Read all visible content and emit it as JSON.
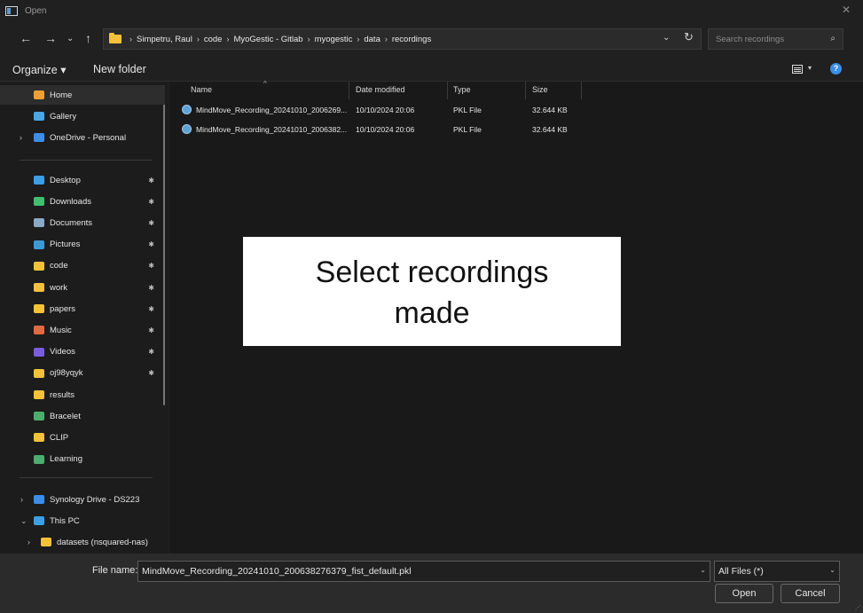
{
  "window": {
    "title": "Open"
  },
  "nav": {
    "breadcrumbs": [
      "Simpetru, Raul",
      "code",
      "MyoGestic - Gitlab",
      "myogestic",
      "data",
      "recordings"
    ],
    "search_placeholder": "Search recordings"
  },
  "toolbar": {
    "organize_label": "Organize ▾",
    "new_folder_label": "New folder"
  },
  "sidebar": {
    "group1": [
      {
        "label": "Home",
        "icon": "home-icon",
        "color": "#f0a030",
        "selected": true
      },
      {
        "label": "Gallery",
        "icon": "gallery-icon",
        "color": "#4aa8e8"
      },
      {
        "label": "OneDrive - Personal",
        "icon": "cloud-icon",
        "color": "#3b8eea",
        "expandable": true
      }
    ],
    "group2": [
      {
        "label": "Desktop",
        "icon": "desktop-icon",
        "color": "#3b9ee8"
      },
      {
        "label": "Downloads",
        "icon": "download-icon",
        "color": "#3fbf6f"
      },
      {
        "label": "Documents",
        "icon": "documents-icon",
        "color": "#8aa8c8"
      },
      {
        "label": "Pictures",
        "icon": "pictures-icon",
        "color": "#3a9ad9"
      },
      {
        "label": "code",
        "icon": "folder-icon",
        "color": "#f3c13a"
      },
      {
        "label": "work",
        "icon": "folder-icon",
        "color": "#f3c13a"
      },
      {
        "label": "papers",
        "icon": "folder-icon",
        "color": "#f3c13a"
      },
      {
        "label": "Music",
        "icon": "music-icon",
        "color": "#e26a3f"
      },
      {
        "label": "Videos",
        "icon": "videos-icon",
        "color": "#7a5ce0"
      },
      {
        "label": "oj98yqyk",
        "icon": "folder-icon",
        "color": "#f3c13a"
      },
      {
        "label": "results",
        "icon": "folder-icon",
        "color": "#f3c13a"
      },
      {
        "label": "Bracelet",
        "icon": "shared-folder-icon",
        "color": "#4cae6e"
      },
      {
        "label": "CLIP",
        "icon": "folder-icon",
        "color": "#f3c13a"
      },
      {
        "label": "Learning",
        "icon": "shared-folder-icon",
        "color": "#4cae6e"
      }
    ],
    "group3": [
      {
        "label": "Synology Drive - DS223",
        "icon": "drive-icon",
        "color": "#3b8eea",
        "expander": "›"
      },
      {
        "label": "This PC",
        "icon": "pc-icon",
        "color": "#3ba0e8",
        "expander": "⌄"
      },
      {
        "label": "datasets (nsquared-nas)",
        "icon": "network-drive-icon",
        "color": "#f3c13a",
        "expander": "›"
      }
    ]
  },
  "columns": {
    "name": "Name",
    "date": "Date modified",
    "type": "Type",
    "size": "Size"
  },
  "files": [
    {
      "name": "MindMove_Recording_20241010_2006269...",
      "date": "10/10/2024 20:06",
      "type": "PKL File",
      "size": "32.644 KB"
    },
    {
      "name": "MindMove_Recording_20241010_2006382...",
      "date": "10/10/2024 20:06",
      "type": "PKL File",
      "size": "32.644 KB"
    }
  ],
  "overlay": {
    "line1": "Select recordings",
    "line2": "made"
  },
  "bottom": {
    "file_name_label": "File name:",
    "file_name_value": "MindMove_Recording_20241010_200638276379_fist_default.pkl",
    "filter_value": "All Files (*)",
    "open_label": "Open",
    "cancel_label": "Cancel"
  }
}
